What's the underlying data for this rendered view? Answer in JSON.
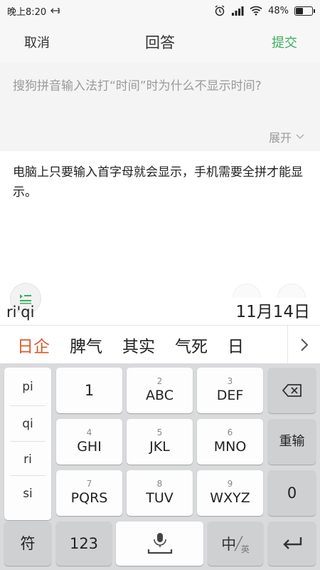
{
  "status_bar": {
    "time": "晚上8:20",
    "battery": "48%",
    "battery_level": 0.48,
    "icons": [
      "usb-icon",
      "alarm-icon",
      "signal-icon",
      "wifi-icon",
      "battery-icon"
    ]
  },
  "header": {
    "cancel": "取消",
    "title": "回答",
    "submit": "提交",
    "submit_color": "#3cae5c"
  },
  "question": {
    "text": "搜狗拼音输入法打“时间”时为什么不显示时间?",
    "expand": "展开"
  },
  "answer": {
    "text": "电脑上只要输入首字母就会显示，手机需要全拼才能显示。"
  },
  "composition": {
    "pinyin": "ri'qi",
    "preview": "11月14日"
  },
  "candidates": {
    "items": [
      "日企",
      "脾气",
      "其实",
      "气死",
      "日"
    ],
    "highlight_color": "#e05a2b"
  },
  "keyboard": {
    "pinyin_options": [
      "pi",
      "qi",
      "ri",
      "si"
    ],
    "keys": {
      "k1": {
        "label": "1"
      },
      "k2": {
        "num": "2",
        "label": "ABC"
      },
      "k3": {
        "num": "3",
        "label": "DEF"
      },
      "k4": {
        "num": "4",
        "label": "GHI"
      },
      "k5": {
        "num": "5",
        "label": "JKL"
      },
      "k6": {
        "num": "6",
        "label": "MNO"
      },
      "k7": {
        "num": "7",
        "label": "PQRS"
      },
      "k8": {
        "num": "8",
        "label": "TUV"
      },
      "k9": {
        "num": "9",
        "label": "WXYZ"
      }
    },
    "reinput": "重输",
    "zero": "0",
    "symbol": "符",
    "num_switch": "123",
    "lang_zh": "中",
    "lang_en": "英"
  }
}
